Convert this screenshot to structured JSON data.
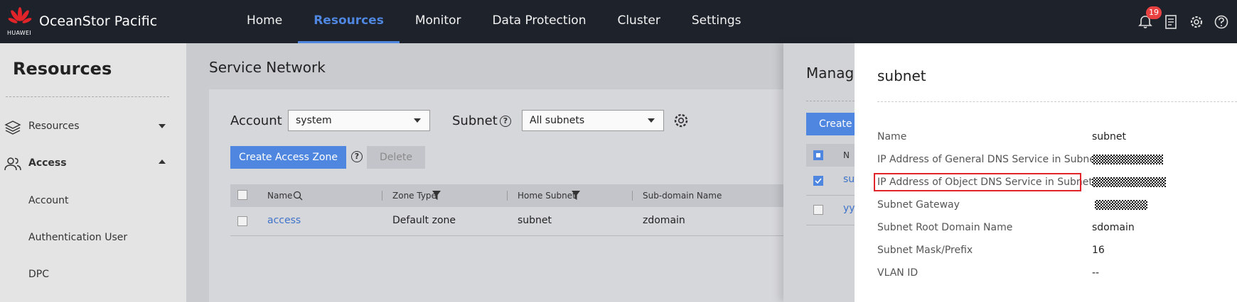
{
  "header": {
    "brand": "HUAWEI",
    "app_title": "OceanStor Pacific",
    "nav": [
      "Home",
      "Resources",
      "Monitor",
      "Data Protection",
      "Cluster",
      "Settings"
    ],
    "active_nav": "Resources",
    "notification_count": "19",
    "icons": [
      "bell-icon",
      "document-icon",
      "gear-icon",
      "help-icon"
    ],
    "accent_color": "#4f87e0",
    "bg_color": "#1e222b"
  },
  "sidebar": {
    "title": "Resources",
    "groups": [
      {
        "label": "Resources",
        "icon": "layers-icon",
        "expanded": false
      },
      {
        "label": "Access",
        "icon": "users-icon",
        "expanded": true
      }
    ],
    "sub_items": [
      "Account",
      "Authentication User",
      "DPC"
    ]
  },
  "main": {
    "title": "Service Network",
    "account_label": "Account",
    "account_value": "system",
    "subnet_label": "Subnet",
    "subnet_value": "All subnets",
    "create_button": "Create Access Zone",
    "delete_button": "Delete",
    "table": {
      "headers": [
        "Name",
        "Zone Type",
        "Home Subnet",
        "Sub-domain Name"
      ],
      "rows": [
        [
          "access",
          "Default zone",
          "subnet",
          "zdomain"
        ]
      ]
    }
  },
  "mid_panel": {
    "title": "Manage",
    "create_button": "Create",
    "col_initial": "N",
    "row1": "su",
    "row2": "yy"
  },
  "details": {
    "title": "subnet",
    "fields": [
      {
        "key": "Name",
        "value": "subnet"
      },
      {
        "key": "IP Address of General DNS Service in Subnet",
        "value": ""
      },
      {
        "key": "IP Address of Object DNS Service in Subnet",
        "value": ""
      },
      {
        "key": "Subnet Gateway",
        "value": ""
      },
      {
        "key": "Subnet Root Domain Name",
        "value": "sdomain"
      },
      {
        "key": "Subnet Mask/Prefix",
        "value": "16"
      },
      {
        "key": "VLAN ID",
        "value": "--"
      }
    ],
    "highlight_color": "#e0242a"
  }
}
